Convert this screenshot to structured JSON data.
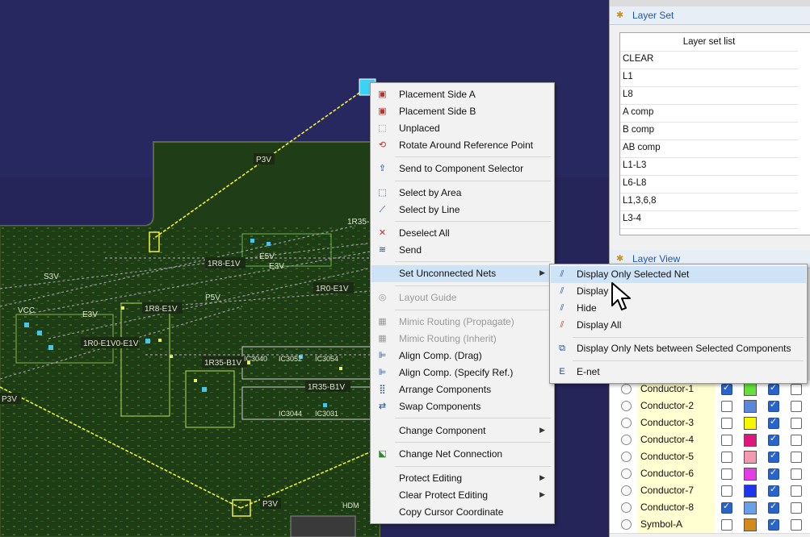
{
  "canvas": {
    "net_labels": [
      "P3V",
      "P3V",
      "P3V",
      "1R8-E1V",
      "1R0-E1V",
      "1R35-B1V",
      "1R35-B1V",
      "1R8-E1V",
      "1R0-E1V",
      "E5V",
      "E3V",
      "S3V",
      "P5V",
      "VCC",
      "1R35",
      "IC3040",
      "IC3052",
      "IC3054",
      "IC3044",
      "IC3031",
      "HDM"
    ]
  },
  "context_menu": {
    "items": [
      {
        "label": "Placement Side A",
        "icon": "placement-side-a-icon"
      },
      {
        "label": "Placement Side B",
        "icon": "placement-side-b-icon"
      },
      {
        "label": "Unplaced",
        "icon": "unplaced-icon"
      },
      {
        "label": "Rotate Around Reference Point",
        "icon": "rotate-icon"
      },
      {
        "label": "Send to Component Selector",
        "icon": "component-selector-icon"
      },
      {
        "label": "Select by Area",
        "icon": "select-area-icon"
      },
      {
        "label": "Select by Line",
        "icon": "select-line-icon"
      },
      {
        "label": "Deselect All",
        "icon": "deselect-icon"
      },
      {
        "label": "Send",
        "icon": "send-icon"
      },
      {
        "label": "Set Unconnected Nets",
        "icon": "",
        "submenu": true
      },
      {
        "label": "Layout Guide",
        "icon": "layout-guide-icon",
        "disabled": true
      },
      {
        "label": "Mimic Routing (Propagate)",
        "icon": "mimic-propagate-icon",
        "disabled": true
      },
      {
        "label": "Mimic Routing (Inherit)",
        "icon": "mimic-inherit-icon",
        "disabled": true
      },
      {
        "label": "Align Comp. (Drag)",
        "icon": "align-drag-icon"
      },
      {
        "label": "Align Comp. (Specify Ref.)",
        "icon": "align-ref-icon"
      },
      {
        "label": "Arrange Components",
        "icon": "arrange-icon"
      },
      {
        "label": "Swap Components",
        "icon": "swap-icon"
      },
      {
        "label": "Change Component",
        "icon": "",
        "submenu": true
      },
      {
        "label": "Change Net Connection",
        "icon": "change-net-icon"
      },
      {
        "label": "Protect Editing",
        "icon": "",
        "submenu": true
      },
      {
        "label": "Clear Protect Editing",
        "icon": "",
        "submenu": true
      },
      {
        "label": "Copy Cursor Coordinate",
        "icon": ""
      }
    ]
  },
  "submenu": {
    "items": [
      {
        "label": "Display Only Selected Net",
        "icon": "net-display-selected-icon"
      },
      {
        "label": "Display",
        "icon": "net-display-icon"
      },
      {
        "label": "Hide",
        "icon": "net-hide-icon"
      },
      {
        "label": "Display All",
        "icon": "net-display-all-icon"
      },
      {
        "label": "Display Only Nets between Selected Components",
        "icon": "net-between-components-icon"
      },
      {
        "label": "E-net",
        "icon": "e-net-icon"
      }
    ]
  },
  "layer_set": {
    "title": "Layer Set",
    "list_header": "Layer set list",
    "items": [
      "CLEAR",
      "L1",
      "L8",
      "A comp",
      "B comp",
      "AB comp",
      "L1-L3",
      "L6-L8",
      "L1,3,6,8",
      "L3-4"
    ]
  },
  "layer_view": {
    "title": "Layer View",
    "rows": [
      {
        "name": "Conductor-1",
        "visible": true,
        "color": "#63e13a",
        "selectable": true
      },
      {
        "name": "Conductor-2",
        "visible": false,
        "color": "#5c86d9",
        "selectable": true
      },
      {
        "name": "Conductor-3",
        "visible": false,
        "color": "#f7f700",
        "selectable": true
      },
      {
        "name": "Conductor-4",
        "visible": false,
        "color": "#e0157e",
        "selectable": true
      },
      {
        "name": "Conductor-5",
        "visible": false,
        "color": "#f39ab2",
        "selectable": true
      },
      {
        "name": "Conductor-6",
        "visible": false,
        "color": "#e43de8",
        "selectable": true
      },
      {
        "name": "Conductor-7",
        "visible": false,
        "color": "#1e35ee",
        "selectable": true
      },
      {
        "name": "Conductor-8",
        "visible": true,
        "color": "#6aa0e8",
        "selectable": true
      },
      {
        "name": "Symbol-A",
        "visible": false,
        "color": "#d48a1a",
        "selectable": true
      }
    ]
  }
}
